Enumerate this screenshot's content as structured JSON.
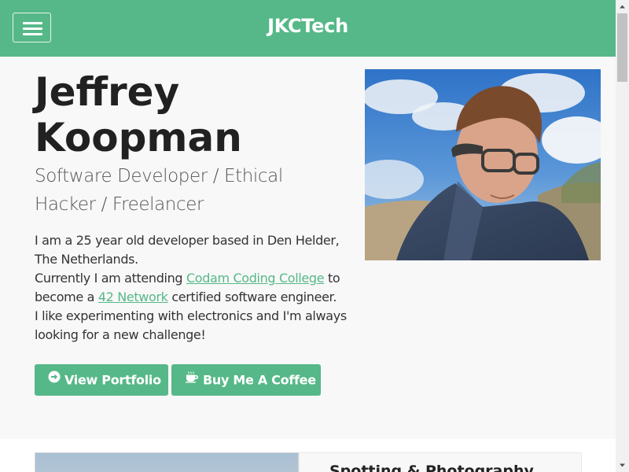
{
  "navbar": {
    "brand": "JKCTech",
    "menu_icon": "hamburger-menu-icon",
    "color": "#56b888"
  },
  "hero": {
    "name_line1": "Jeffrey",
    "name_line2": "Koopman",
    "subtitle": "Software Developer / Ethical Hacker / Freelancer",
    "bio": {
      "p1": "I am a 25 year old developer based in Den Helder, The Netherlands.",
      "p2_before": "Currently I am attending ",
      "p2_link": "Codam Coding College",
      "p2_after": " to become a ",
      "p2_link2": "42 Network",
      "p2_end": " certified software engineer.",
      "p3": "I like experimenting with electronics and I'm always looking for a new challenge!"
    },
    "buttons": {
      "portfolio_label": "View Portfolio",
      "portfolio_icon": "arrow-circle-right-icon",
      "coffee_label": "Buy Me A Coffee",
      "coffee_icon": "coffee-cup-icon"
    },
    "photo_icon": "profile-photo"
  },
  "section": {
    "card_title": "Spotting & Photography"
  },
  "colors": {
    "accent": "#56b888",
    "hero_bg": "#f8f8f8"
  }
}
